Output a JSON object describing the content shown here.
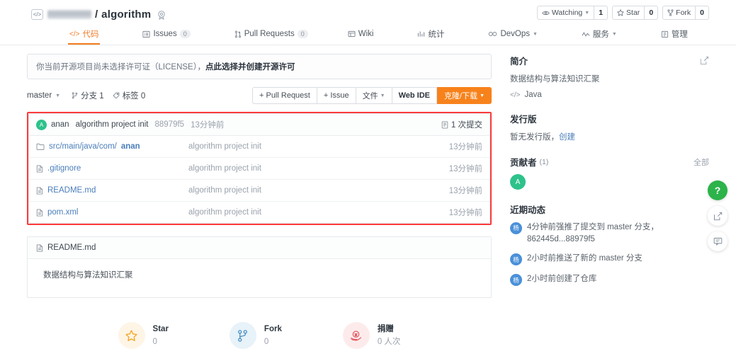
{
  "header": {
    "code_icon": "code-icon",
    "owner_redacted": true,
    "separator": "/",
    "repo_name": "algorithm",
    "badge_icon": "medal-icon",
    "actions": [
      {
        "icon": "eye-icon",
        "label": "Watching",
        "has_caret": true,
        "count": "1"
      },
      {
        "icon": "star-icon",
        "label": "Star",
        "has_caret": false,
        "count": "0"
      },
      {
        "icon": "fork-icon",
        "label": "Fork",
        "has_caret": false,
        "count": "0"
      }
    ]
  },
  "tabs": [
    {
      "icon": "code-icon",
      "label": "代码",
      "count": null,
      "active": true,
      "caret": false
    },
    {
      "icon": "issue-icon",
      "label": "Issues",
      "count": "0",
      "active": false,
      "caret": false
    },
    {
      "icon": "pull-request-icon",
      "label": "Pull Requests",
      "count": "0",
      "active": false,
      "caret": false
    },
    {
      "icon": "wiki-icon",
      "label": "Wiki",
      "count": null,
      "active": false,
      "caret": false
    },
    {
      "icon": "stats-icon",
      "label": "统计",
      "count": null,
      "active": false,
      "caret": false
    },
    {
      "icon": "devops-icon",
      "label": "DevOps",
      "count": null,
      "active": false,
      "caret": true
    },
    {
      "icon": "service-icon",
      "label": "服务",
      "count": null,
      "active": false,
      "caret": true
    },
    {
      "icon": "manage-icon",
      "label": "管理",
      "count": null,
      "active": false,
      "caret": false
    }
  ],
  "license_notice": {
    "text": "你当前开源项目尚未选择许可证（LICENSE），",
    "link": "点此选择并创建开源许可"
  },
  "branch_bar": {
    "branch": "master",
    "branches_label": "分支 1",
    "tags_label": "标签 0",
    "buttons": [
      {
        "label": "+ Pull Request",
        "style": "plain"
      },
      {
        "label": "+ Issue",
        "style": "plain"
      },
      {
        "label": "文件",
        "style": "plain",
        "caret": true
      },
      {
        "label": "Web IDE",
        "style": "bold"
      },
      {
        "label": "克隆/下载",
        "style": "primary",
        "caret": true
      }
    ]
  },
  "commit_row": {
    "avatar_letter": "A",
    "user": "anan",
    "message": "algorithm project init",
    "sha": "88979f5",
    "time": "13分钟前",
    "commits_icon": "commit-icon",
    "commits_label": "1 次提交"
  },
  "files": [
    {
      "icon": "folder-icon",
      "name": "src/main/java/com/",
      "name_bold": "anan",
      "message": "algorithm project init",
      "time": "13分钟前"
    },
    {
      "icon": "file-icon",
      "name": ".gitignore",
      "name_bold": "",
      "message": "algorithm project init",
      "time": "13分钟前"
    },
    {
      "icon": "file-icon",
      "name": "README.md",
      "name_bold": "",
      "message": "algorithm project init",
      "time": "13分钟前"
    },
    {
      "icon": "file-icon",
      "name": "pom.xml",
      "name_bold": "",
      "message": "algorithm project init",
      "time": "13分钟前"
    }
  ],
  "readme": {
    "icon": "file-icon",
    "title": "README.md",
    "content": "数据结构与算法知识汇聚"
  },
  "sfd": [
    {
      "icon": "star-icon",
      "label": "Star",
      "value": "0",
      "color": "#f5a623"
    },
    {
      "icon": "fork-icon",
      "label": "Fork",
      "value": "0",
      "color": "#4a90c2"
    },
    {
      "icon": "donate-icon",
      "label": "捐赠",
      "value": "0 人次",
      "color": "#e35b63"
    }
  ],
  "sidebar": {
    "intro": {
      "title": "简介",
      "edit_icon": "edit-icon",
      "description": "数据结构与算法知识汇聚",
      "lang_icon": "code-icon",
      "language": "Java"
    },
    "releases": {
      "title": "发行版",
      "text": "暂无发行版，",
      "link": "创建"
    },
    "contributors": {
      "title": "贡献者",
      "count": "(1)",
      "all_label": "全部",
      "avatars": [
        {
          "letter": "A",
          "color": "#2ec28b"
        }
      ]
    },
    "activity": {
      "title": "近期动态",
      "items": [
        {
          "avatar": "杨",
          "text": "4分钟前强推了提交到 master 分支，862445d...88979f5"
        },
        {
          "avatar": "杨",
          "text": "2小时前推送了新的 master 分支"
        },
        {
          "avatar": "杨",
          "text": "2小时前创建了仓库"
        }
      ]
    }
  },
  "float_buttons": [
    {
      "icon": "help-icon",
      "label": "?",
      "style": "help"
    },
    {
      "icon": "share-icon",
      "label": "",
      "style": "plain"
    },
    {
      "icon": "feedback-icon",
      "label": "",
      "style": "plain"
    }
  ],
  "colors": {
    "accent_orange": "#f7821b",
    "annotation_red": "#fb3b3b",
    "link_blue": "#4a7ebb",
    "avatar_green": "#2ec28b",
    "help_green": "#2cb34a"
  }
}
